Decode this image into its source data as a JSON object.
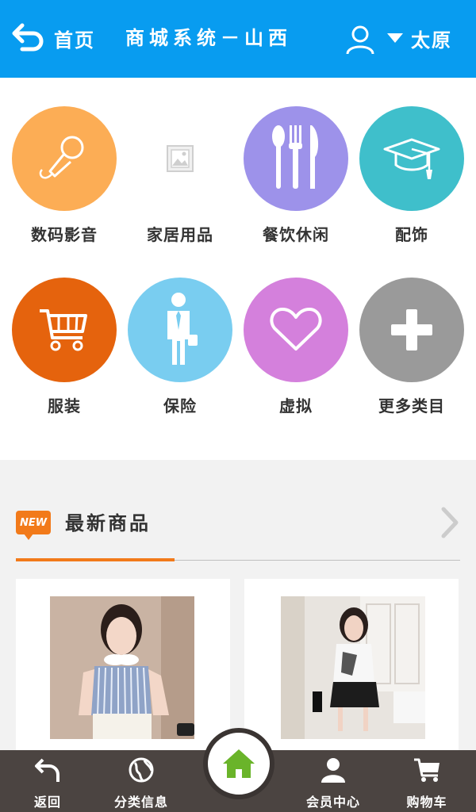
{
  "header": {
    "back_label": "首页",
    "title": "商城系统－山西",
    "city": "太原",
    "icons": {
      "back": "back-arrow-icon",
      "user": "user-icon",
      "caret": "caret-down-icon"
    }
  },
  "categories": [
    {
      "label": "数码影音",
      "icon": "microphone-icon",
      "color": "#fcad55"
    },
    {
      "label": "家居用品",
      "icon": "image-placeholder-icon",
      "color": "#ffffff"
    },
    {
      "label": "餐饮休闲",
      "icon": "cutlery-icon",
      "color": "#9d92ea"
    },
    {
      "label": "配饰",
      "icon": "graduation-cap-icon",
      "color": "#3fbfcb"
    },
    {
      "label": "服装",
      "icon": "shopping-cart-icon",
      "color": "#e5630d"
    },
    {
      "label": "保险",
      "icon": "businessman-icon",
      "color": "#79cdf0"
    },
    {
      "label": "虚拟",
      "icon": "heart-icon",
      "color": "#d480dc"
    },
    {
      "label": "更多类目",
      "icon": "plus-icon",
      "color": "#9a9a9a"
    }
  ],
  "new_products": {
    "badge": "NEW",
    "title": "最新商品",
    "accent_color": "#f27a1a",
    "items": [
      {
        "image": "product-photo-woman-striped-top"
      },
      {
        "image": "product-photo-woman-white-tee-skirt"
      }
    ]
  },
  "bottom_nav": {
    "items": [
      {
        "label": "返回",
        "icon": "back-arrow-icon"
      },
      {
        "label": "分类信息",
        "icon": "globe-icon"
      },
      {
        "label": "会员中心",
        "icon": "user-icon"
      },
      {
        "label": "购物车",
        "icon": "shopping-cart-icon"
      }
    ],
    "home_icon": "home-icon",
    "bg_color": "#4b4441"
  },
  "colors": {
    "primary": "#089cf0"
  }
}
